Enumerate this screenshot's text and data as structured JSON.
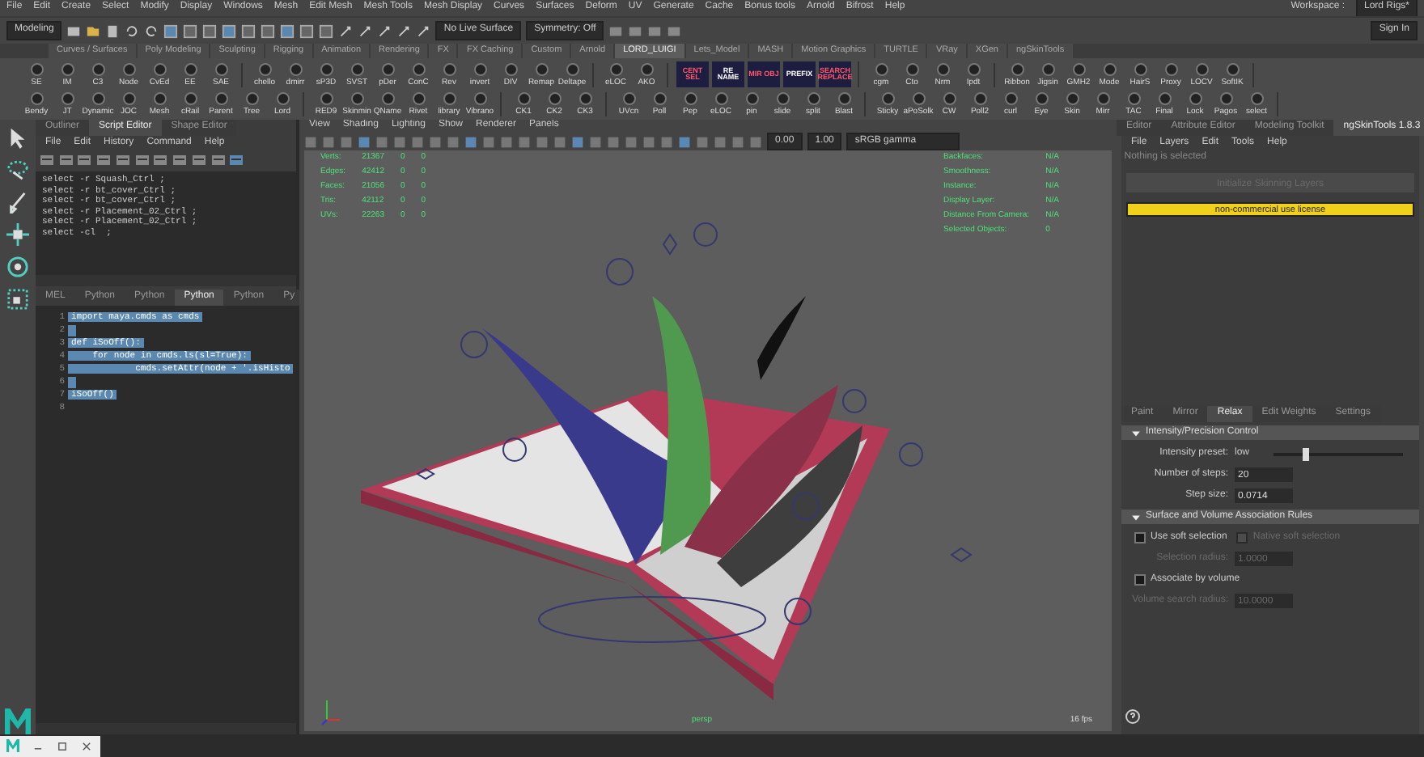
{
  "menu_bar": {
    "items": [
      "File",
      "Edit",
      "Create",
      "Select",
      "Modify",
      "Display",
      "Windows",
      "Mesh",
      "Edit Mesh",
      "Mesh Tools",
      "Mesh Display",
      "Curves",
      "Surfaces",
      "Deform",
      "UV",
      "Generate",
      "Cache",
      "Bonus tools",
      "Arnold",
      "Bifrost",
      "Help"
    ],
    "workspace_label": "Workspace :",
    "workspace": "Lord Rigs*"
  },
  "status_line": {
    "mode": "Modeling",
    "live_surface": "No Live Surface",
    "symmetry": "Symmetry: Off",
    "sign_in": "Sign In"
  },
  "shelf_tabs": [
    {
      "label": "Curves / Surfaces",
      "selected": false
    },
    {
      "label": "Poly Modeling",
      "selected": false
    },
    {
      "label": "Sculpting",
      "selected": false
    },
    {
      "label": "Rigging",
      "selected": false
    },
    {
      "label": "Animation",
      "selected": false
    },
    {
      "label": "Rendering",
      "selected": false
    },
    {
      "label": "FX",
      "selected": false
    },
    {
      "label": "FX Caching",
      "selected": false
    },
    {
      "label": "Custom",
      "selected": false
    },
    {
      "label": "Arnold",
      "selected": false
    },
    {
      "label": "LORD_LUIGI",
      "selected": true
    },
    {
      "label": "Lets_Model",
      "selected": false
    },
    {
      "label": "MASH",
      "selected": false
    },
    {
      "label": "Motion Graphics",
      "selected": false
    },
    {
      "label": "TURTLE",
      "selected": false
    },
    {
      "label": "VRay",
      "selected": false
    },
    {
      "label": "XGen",
      "selected": false
    },
    {
      "label": "ngSkinTools",
      "selected": false
    }
  ],
  "shelf_rows": [
    [
      {
        "kind": "button",
        "labels": [
          "SE",
          "IM",
          "C3",
          "Node",
          "CvEd",
          "EE",
          "SAE"
        ]
      },
      {
        "kind": "button",
        "labels": [
          "chello",
          "dmirr",
          "sP3D",
          "SVST",
          "pDer",
          "ConC",
          "Rev",
          "invert",
          "DIV",
          "Remap",
          "Deltape"
        ]
      },
      {
        "kind": "button",
        "labels": [
          "eLOC",
          "AKO"
        ]
      },
      {
        "kind": "tile",
        "labels": [
          "CENT SEL",
          "RE NAME",
          "MIR OBJ",
          "PREFIX",
          "SEARCH REPLACE"
        ]
      },
      {
        "kind": "button",
        "labels": [
          "cgm",
          "Cto",
          "Nrm",
          "Ipdt"
        ]
      },
      {
        "kind": "button",
        "labels": [
          "Ribbon",
          "Jigsin",
          "GMH2",
          "Mode",
          "HairS",
          "Proxy",
          "LOCV",
          "SoftIK"
        ]
      }
    ],
    [
      {
        "kind": "button",
        "labels": [
          "Bendy",
          "JT",
          "Dynamic",
          "JOC",
          "Mesh",
          "cRail",
          "Parent",
          "Tree",
          "Lord"
        ]
      },
      {
        "kind": "button",
        "labels": [
          "RED9",
          "Skinmin",
          "QName",
          "Rivet",
          "library",
          "Vibrano"
        ]
      },
      {
        "kind": "button",
        "labels": [
          "CK1",
          "CK2",
          "CK3"
        ]
      },
      {
        "kind": "button",
        "labels": [
          "UVcn",
          "Poll",
          "Pep",
          "eLOC",
          "pin",
          "slide",
          "split",
          "Blast"
        ]
      },
      {
        "kind": "button",
        "labels": [
          "Sticky",
          "aPoSolk",
          "CW",
          "Poll2",
          "curl",
          "Eye",
          "Skin",
          "Mirr",
          "TAC",
          "Final",
          "Lock",
          "Pagos",
          "select"
        ]
      }
    ]
  ],
  "script_editor": {
    "tabs": [
      {
        "label": "Outliner",
        "selected": false
      },
      {
        "label": "Script Editor",
        "selected": true
      },
      {
        "label": "Shape Editor",
        "selected": false
      }
    ],
    "menu": [
      "File",
      "Edit",
      "History",
      "Command",
      "Help"
    ],
    "history": [
      "select -r Squash_Ctrl ;",
      "select -r bt_cover_Ctrl ;",
      "select -r bt_cover_Ctrl ;",
      "select -r Placement_02_Ctrl ;",
      "select -r Placement_02_Ctrl ;",
      "select -cl  ;"
    ],
    "input_tabs": [
      {
        "label": "MEL",
        "selected": false
      },
      {
        "label": "Python",
        "selected": false
      },
      {
        "label": "Python",
        "selected": false
      },
      {
        "label": "Python",
        "selected": true
      },
      {
        "label": "Python",
        "selected": false
      },
      {
        "label": "Py",
        "selected": false
      }
    ],
    "code": [
      {
        "number": "1",
        "text": "import maya.cmds as cmds",
        "selected": true
      },
      {
        "number": "2",
        "selected": true
      },
      {
        "number": "3",
        "text": "def iSoOff():",
        "selected": true
      },
      {
        "number": "4",
        "text": "    for node in cmds.ls(sl=True):",
        "selected": true
      },
      {
        "number": "5",
        "text": "            cmds.setAttr(node + '.isHisto",
        "selected": true
      },
      {
        "number": "6",
        "selected": true
      },
      {
        "number": "7",
        "text": "iSoOff()",
        "selected": true
      },
      {
        "number": "8",
        "selected": false
      }
    ]
  },
  "viewport": {
    "menu": [
      "View",
      "Shading",
      "Lighting",
      "Show",
      "Renderer",
      "Panels"
    ],
    "exposure": "0.00",
    "gamma": "1.00",
    "color_space": "sRGB gamma",
    "hud_left": [
      {
        "label": "Verts:",
        "values": [
          "21367",
          "0",
          "0"
        ]
      },
      {
        "label": "Edges:",
        "values": [
          "42412",
          "0",
          "0"
        ]
      },
      {
        "label": "Faces:",
        "values": [
          "21056",
          "0",
          "0"
        ]
      },
      {
        "label": "Tris:",
        "values": [
          "42112",
          "0",
          "0"
        ]
      },
      {
        "label": "UVs:",
        "values": [
          "22263",
          "0",
          "0"
        ]
      }
    ],
    "hud_right": [
      {
        "label": "Backfaces:",
        "value": "N/A"
      },
      {
        "label": "Smoothness:",
        "value": "N/A"
      },
      {
        "label": "Instance:",
        "value": "N/A"
      },
      {
        "label": "Display Layer:",
        "value": "N/A"
      },
      {
        "label": "Distance From Camera:",
        "value": "N/A"
      },
      {
        "label": "Selected Objects:",
        "value": "0"
      }
    ],
    "camera": "persp",
    "fps": "16 fps"
  },
  "right_panel": {
    "tabs": [
      {
        "label": "Editor",
        "selected": false
      },
      {
        "label": "Attribute Editor",
        "selected": false
      },
      {
        "label": "Modeling Toolkit",
        "selected": false
      },
      {
        "label": "ngSkinTools 1.8.3",
        "selected": true
      }
    ],
    "menu": [
      "File",
      "Layers",
      "Edit",
      "Tools",
      "Help"
    ],
    "message": "Nothing is selected",
    "init_button": {
      "label": "Initialize Skinning Layers",
      "disabled": true
    },
    "license": "non-commercial use license",
    "tool_tabs": [
      {
        "label": "Paint",
        "selected": false
      },
      {
        "label": "Mirror",
        "selected": false
      },
      {
        "label": "Relax",
        "selected": true
      },
      {
        "label": "Edit Weights",
        "selected": false
      },
      {
        "label": "Settings",
        "selected": false
      }
    ],
    "sections": [
      {
        "title": "Intensity/Precision Control",
        "expanded": true,
        "rows": [
          {
            "kind": "slider",
            "label": "Intensity preset:",
            "value": "low",
            "level": 0.25
          },
          {
            "kind": "field",
            "label": "Number of steps:",
            "value": "20",
            "disabled": false
          },
          {
            "kind": "field",
            "label": "Step size:",
            "value": "0.0714",
            "disabled": false
          }
        ]
      },
      {
        "title": "Surface and Volume Association Rules",
        "expanded": true,
        "rows": [
          {
            "kind": "checks",
            "items": [
              {
                "label": "Use soft selection",
                "checked": false,
                "disabled": false
              },
              {
                "label": "Native soft selection",
                "checked": false,
                "disabled": true
              }
            ]
          },
          {
            "kind": "field",
            "label": "Selection radius:",
            "value": "1.0000",
            "disabled": true
          },
          {
            "kind": "checks",
            "items": [
              {
                "label": "Associate by volume",
                "checked": false,
                "disabled": false
              }
            ]
          },
          {
            "kind": "field",
            "label": "Volume search radius:",
            "value": "10.0000",
            "disabled": true
          }
        ]
      }
    ]
  }
}
